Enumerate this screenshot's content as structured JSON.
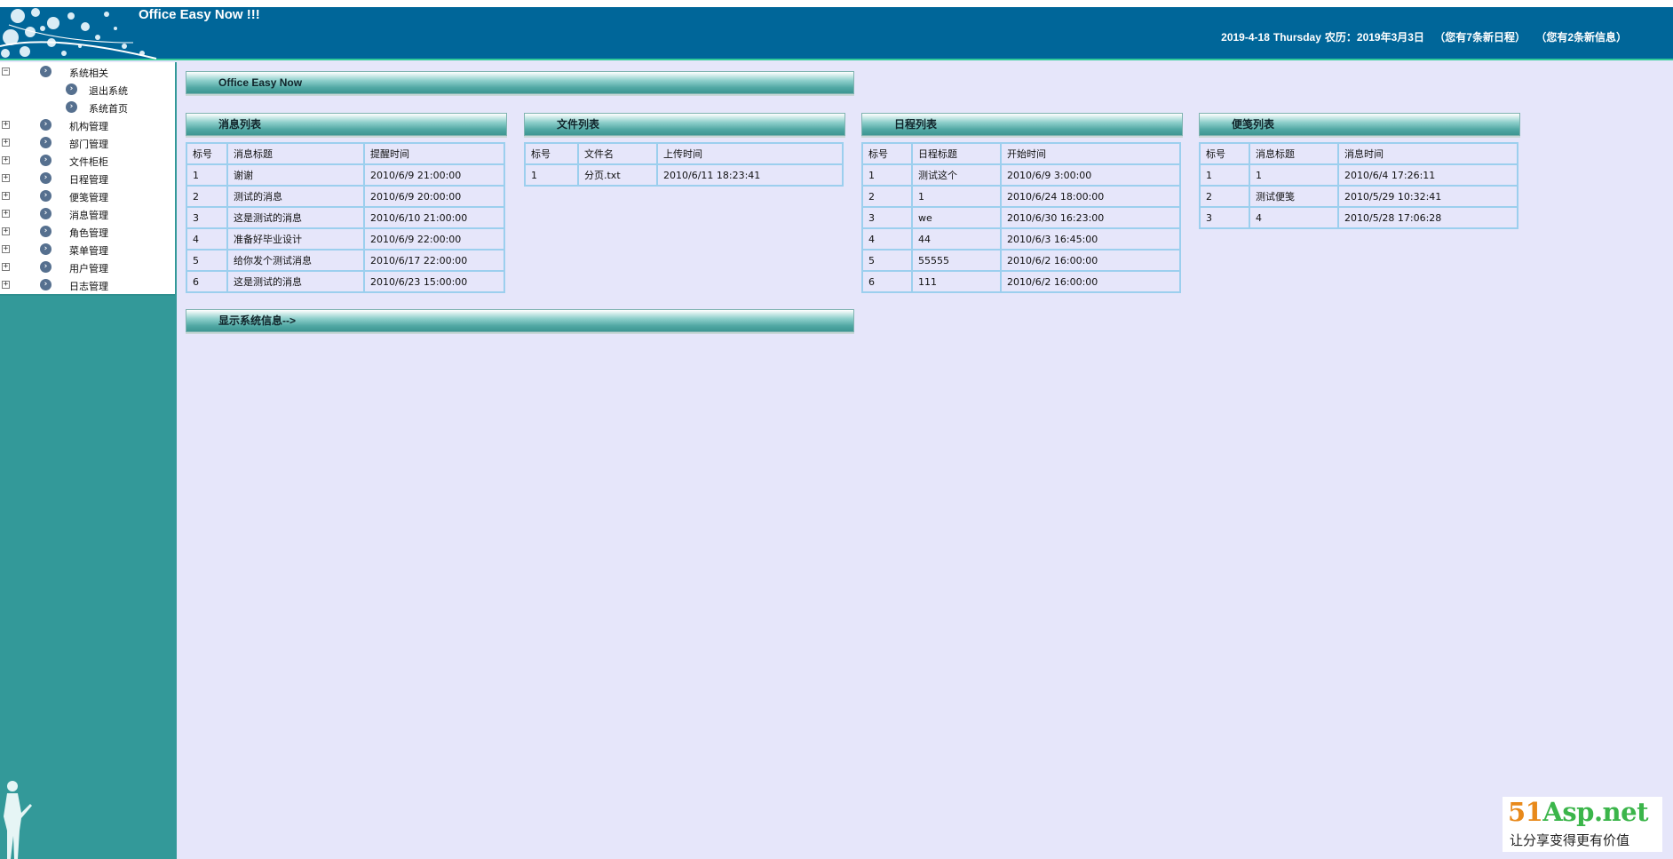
{
  "header": {
    "app_title": "Office Easy Now !!!",
    "date": "2019-4-18",
    "weekday": "Thursday",
    "lunar": "农历：2019年3月3日",
    "new_schedules": "（您有7条新日程）",
    "new_messages": "（您有2条新信息）"
  },
  "sidebar": {
    "items": [
      {
        "label": "系统相关",
        "toggle": "−"
      },
      {
        "label": "退出系统",
        "toggle": ""
      },
      {
        "label": "系统首页",
        "toggle": ""
      },
      {
        "label": "机构管理",
        "toggle": "+"
      },
      {
        "label": "部门管理",
        "toggle": "+"
      },
      {
        "label": "文件柜柜",
        "toggle": "+"
      },
      {
        "label": "日程管理",
        "toggle": "+"
      },
      {
        "label": "便笺管理",
        "toggle": "+"
      },
      {
        "label": "消息管理",
        "toggle": "+"
      },
      {
        "label": "角色管理",
        "toggle": "+"
      },
      {
        "label": "菜单管理",
        "toggle": "+"
      },
      {
        "label": "用户管理",
        "toggle": "+"
      },
      {
        "label": "日志管理",
        "toggle": "+"
      }
    ]
  },
  "main": {
    "top_bar_title": "Office Easy Now",
    "system_info_link": "显示系统信息-->",
    "panels": {
      "messages": {
        "title": "消息列表",
        "headers": [
          "标号",
          "消息标题",
          "提醒时间"
        ],
        "rows": [
          [
            "1",
            "谢谢",
            "2010/6/9 21:00:00"
          ],
          [
            "2",
            "测试的消息",
            "2010/6/9 20:00:00"
          ],
          [
            "3",
            "这是测试的消息",
            "2010/6/10 21:00:00"
          ],
          [
            "4",
            "准备好毕业设计",
            "2010/6/9 22:00:00"
          ],
          [
            "5",
            "给你发个测试消息",
            "2010/6/17 22:00:00"
          ],
          [
            "6",
            "这是测试的消息",
            "2010/6/23 15:00:00"
          ]
        ]
      },
      "files": {
        "title": "文件列表",
        "headers": [
          "标号",
          "文件名",
          "上传时间"
        ],
        "rows": [
          [
            "1",
            "分页.txt",
            "2010/6/11 18:23:41"
          ]
        ]
      },
      "schedules": {
        "title": "日程列表",
        "headers": [
          "标号",
          "日程标题",
          "开始时间"
        ],
        "rows": [
          [
            "1",
            "测试这个",
            "2010/6/9 3:00:00"
          ],
          [
            "2",
            "1",
            "2010/6/24 18:00:00"
          ],
          [
            "3",
            "we",
            "2010/6/30 16:23:00"
          ],
          [
            "4",
            "44",
            "2010/6/3 16:45:00"
          ],
          [
            "5",
            "55555",
            "2010/6/2 16:00:00"
          ],
          [
            "6",
            "111",
            "2010/6/2 16:00:00"
          ]
        ]
      },
      "notes": {
        "title": "便笺列表",
        "headers": [
          "标号",
          "消息标题",
          "消息时间"
        ],
        "rows": [
          [
            "1",
            "1",
            "2010/6/4 17:26:11"
          ],
          [
            "2",
            "测试便笺",
            "2010/5/29 10:32:41"
          ],
          [
            "3",
            "4",
            "2010/5/28 17:06:28"
          ]
        ]
      }
    }
  },
  "watermark": {
    "logo_prefix": "51",
    "logo_rest": "Asp.net",
    "tagline": "让分享变得更有价值"
  },
  "colors": {
    "header_bg": "#006699",
    "sidebar_bg": "#339999",
    "content_bg": "#e6e6fa",
    "table_border": "#9ccfee"
  }
}
